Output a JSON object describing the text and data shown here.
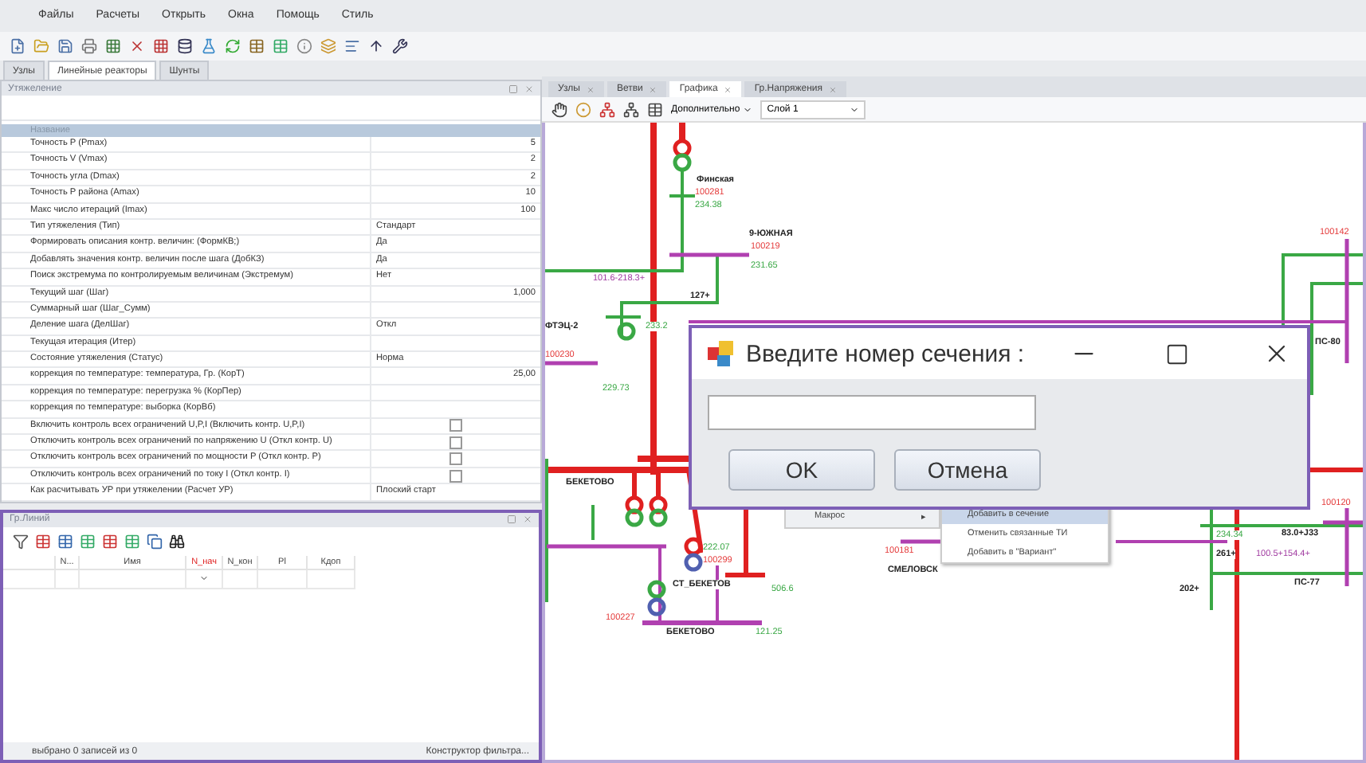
{
  "menu": [
    "Файлы",
    "Расчеты",
    "Открыть",
    "Окна",
    "Помощь",
    "Стиль"
  ],
  "left_tabs": [
    {
      "label": "Узлы",
      "selected": false
    },
    {
      "label": "Линейные реакторы",
      "selected": true
    },
    {
      "label": "Шунты",
      "selected": false
    }
  ],
  "props_panel": {
    "title": "Утяжеление",
    "header": "Название",
    "rows": [
      {
        "kind": "number",
        "name": "Точность P (Pmax)",
        "value": "5"
      },
      {
        "kind": "number",
        "name": "Точность V (Vmax)",
        "value": "2"
      },
      {
        "kind": "number",
        "name": "Точность угла (Dmax)",
        "value": "2"
      },
      {
        "kind": "number",
        "name": "Точность P района (Amax)",
        "value": "10"
      },
      {
        "kind": "number",
        "name": "Макс число итераций (Imax)",
        "value": "100"
      },
      {
        "kind": "text",
        "name": "Тип утяжеления (Тип)",
        "value": "Стандарт"
      },
      {
        "kind": "text",
        "name": "Формировать описания контр. величин: (ФормКВ;)",
        "value": "Да"
      },
      {
        "kind": "text",
        "name": "Добавлять значения контр. величин после шага (ДобКЗ)",
        "value": "Да"
      },
      {
        "kind": "text",
        "name": "Поиск экстремума по контролируемым величинам (Экстремум)",
        "value": "Нет"
      },
      {
        "kind": "number",
        "name": "Текущий шаг (Шаг)",
        "value": "1,000"
      },
      {
        "kind": "text",
        "name": "Суммарный шаг (Шаг_Сумм)"
      },
      {
        "kind": "text",
        "name": "Деление шага (ДелШаг)",
        "value": "Откл"
      },
      {
        "kind": "text",
        "name": "Текущая итерация (Итер)"
      },
      {
        "kind": "text",
        "name": "Состояние утяжеления (Статус)",
        "value": "Норма"
      },
      {
        "kind": "number",
        "name": "коррекция по температуре: температура, Гр. (КорТ)",
        "value": "25,00"
      },
      {
        "kind": "text",
        "name": "коррекция по температуре: перегрузка % (КорПер)"
      },
      {
        "kind": "text",
        "name": "коррекция по температуре: выборка (КорВб)"
      },
      {
        "kind": "check",
        "name": "Включить контроль всех ограничений U,P,I (Включить контр. U,P,I)",
        "checked": false
      },
      {
        "kind": "check",
        "name": "Отключить контроль всех ограничений по напряжению U (Откл контр. U)",
        "checked": false
      },
      {
        "kind": "check",
        "name": "Отключить контроль всех ограничений по мощности P (Откл контр. P)",
        "checked": false
      },
      {
        "kind": "check",
        "name": "Отключить контроль всех ограничений по току I (Откл контр. I)",
        "checked": false
      },
      {
        "kind": "text",
        "name": "Как расчитывать УР при утяжелении (Расчет УР)",
        "value": "Плоский старт"
      }
    ]
  },
  "lines_panel": {
    "title": "Гр.Линий",
    "columns": [
      {
        "label": "N...",
        "highlighted": false
      },
      {
        "label": "Имя",
        "highlighted": false
      },
      {
        "label": "N_нач",
        "highlighted": true
      },
      {
        "label": "N_кон",
        "highlighted": false
      },
      {
        "label": "Pl",
        "highlighted": false
      },
      {
        "label": "Кдоп",
        "highlighted": false
      }
    ],
    "status": "выбрано 0 записей из 0",
    "filter_link": "Конструктор фильтра..."
  },
  "doc_tabs": [
    {
      "label": "Узлы",
      "selected": false
    },
    {
      "label": "Ветви",
      "selected": false
    },
    {
      "label": "Графика",
      "selected": true
    },
    {
      "label": "Гр.Напряжения",
      "selected": false
    }
  ],
  "graphics_toolbar": {
    "menu": "Дополнительно",
    "layer": "Слой 1"
  },
  "schematic": {
    "labels": [
      {
        "kind": "name",
        "text": "Финская"
      },
      {
        "kind": "id",
        "text": "100281"
      },
      {
        "kind": "voltage",
        "text": "234.38"
      },
      {
        "kind": "name",
        "text": "9-ЮЖНАЯ"
      },
      {
        "kind": "id",
        "text": "100219"
      },
      {
        "kind": "voltage",
        "text": "231.65"
      },
      {
        "kind": "id",
        "text": "100142"
      },
      {
        "kind": "name",
        "text": "127+"
      },
      {
        "kind": "flow",
        "text": "101.6-218.3+"
      },
      {
        "kind": "name",
        "text": "ФТЭЦ-2"
      },
      {
        "kind": "voltage",
        "text": "233.2"
      },
      {
        "kind": "id",
        "text": "100230"
      },
      {
        "kind": "voltage",
        "text": "229.73"
      },
      {
        "kind": "name",
        "text": "БЕКЕТОВО"
      },
      {
        "kind": "id",
        "text": "100181"
      },
      {
        "kind": "name",
        "text": "СМЕЛОВСК"
      },
      {
        "kind": "id",
        "text": "100120"
      },
      {
        "kind": "name",
        "text": "83.0+J33"
      },
      {
        "kind": "voltage",
        "text": "234.34"
      },
      {
        "kind": "name",
        "text": "261+"
      },
      {
        "kind": "flow",
        "text": "100.5+154.4+"
      },
      {
        "kind": "name",
        "text": "ПС-77"
      },
      {
        "kind": "name",
        "text": "202+"
      },
      {
        "kind": "name",
        "text": "ПС-80"
      },
      {
        "kind": "voltage",
        "text": "222.07"
      },
      {
        "kind": "id",
        "text": "100299"
      },
      {
        "kind": "name",
        "text": "СТ_БЕКЕТОВ"
      },
      {
        "kind": "voltage",
        "text": "506.6"
      },
      {
        "kind": "id",
        "text": "100227"
      },
      {
        "kind": "name",
        "text": "БЕКЕТОВО"
      },
      {
        "kind": "voltage",
        "text": "121.25"
      }
    ]
  },
  "context_menu": {
    "item": "Макрос",
    "arrow": "▸",
    "submenu": [
      {
        "label": "Добавить в сечение",
        "selected": true
      },
      {
        "label": "Отменить связанные ТИ",
        "selected": false
      },
      {
        "label": "Добавить в \"Вариант\"",
        "selected": false
      }
    ]
  },
  "dialog": {
    "title": "Введите номер сечения :",
    "buttons": [
      "OK",
      "Отмена"
    ]
  }
}
